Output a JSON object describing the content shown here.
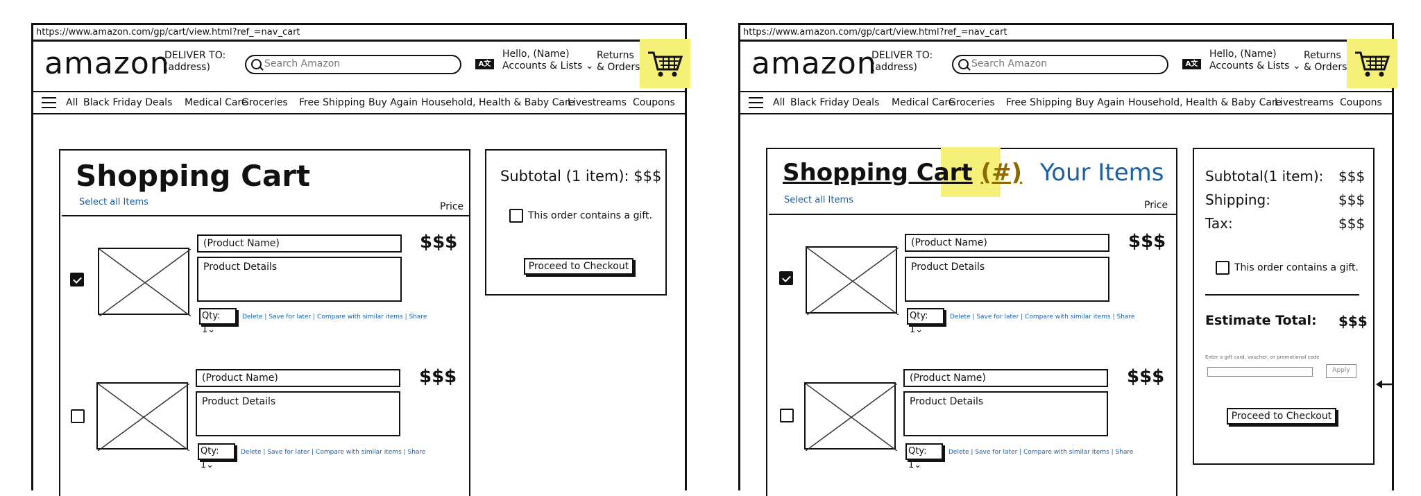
{
  "url": "https://www.amazon.com/gp/cart/view.html?ref_=nav_cart",
  "logo": "amazon",
  "deliver": {
    "line1": "DELIVER TO:",
    "line2": "(address)"
  },
  "search_placeholder": "Search Amazon",
  "flag_label": "A文",
  "account": {
    "line1": "Hello, (Name)",
    "line2": "Accounts & Lists"
  },
  "returns": {
    "line1": "Returns",
    "line2": "& Orders"
  },
  "nav_items": [
    "All",
    "Black Friday Deals",
    "Medical Care",
    "Groceries",
    "Free Shipping",
    "Buy Again",
    "Household, Health & Baby Care",
    "Livestreams",
    "Coupons"
  ],
  "left": {
    "title": "Shopping Cart",
    "select_all": "Select all Items",
    "price_header": "Price",
    "subtotal": "Subtotal (1 item): $$$",
    "gift": "This order contains a gift.",
    "checkout": "Proceed to Checkout"
  },
  "right": {
    "title": "Shopping Cart",
    "count": "(#)",
    "your_items": "Your Items",
    "select_all": "Select all Items",
    "price_header": "Price",
    "subtotal_label": "Subtotal(1 item):",
    "subtotal_value": "$$$",
    "shipping_label": "Shipping:",
    "shipping_value": "$$$",
    "tax_label": "Tax:",
    "tax_value": "$$$",
    "gift": "This order contains a gift.",
    "estimate_label": "Estimate Total:",
    "estimate_value": "$$$",
    "promo_label": "Enter a gift card, voucher, or promotional code",
    "apply": "Apply",
    "checkout": "Proceed to Checkout"
  },
  "item": {
    "name": "(Product Name)",
    "details": "Product Details",
    "price": "$$$",
    "qty": "Qty: 1",
    "links": "Delete | Save for later | Compare with similar items | Share"
  },
  "items_checked": [
    true,
    false
  ],
  "colors": {
    "highlight": "#f5f178",
    "link": "#1a5fa8",
    "ink": "#111111"
  },
  "icons": [
    "search-icon",
    "language-flag-icon",
    "chevron-down-icon",
    "cart-icon",
    "hamburger-icon",
    "image-placeholder-icon",
    "checkbox-icon",
    "arrow-left-icon"
  ]
}
